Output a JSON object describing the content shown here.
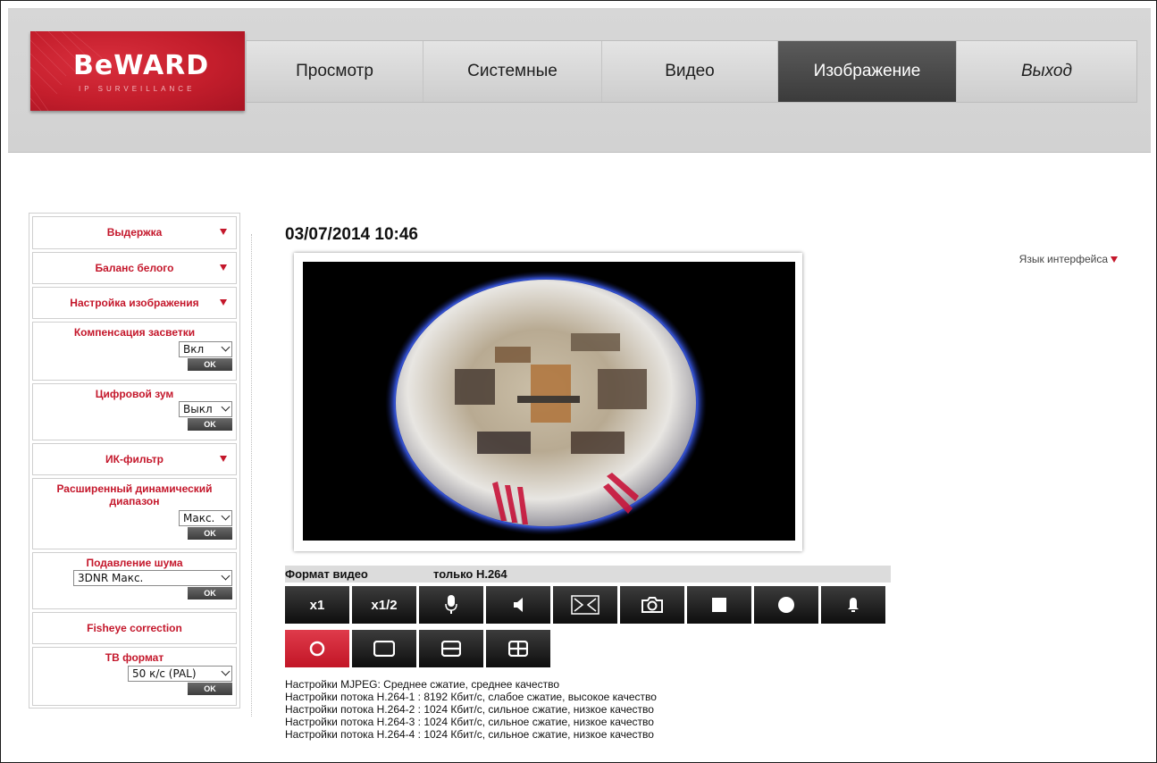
{
  "header": {
    "logo_text": "BeWARD",
    "logo_sub": "IP SURVEILLANCE",
    "nav": [
      {
        "label": "Просмотр"
      },
      {
        "label": "Системные"
      },
      {
        "label": "Видео"
      },
      {
        "label": "Изображение",
        "active": true
      },
      {
        "label": "Выход"
      }
    ]
  },
  "sidebar": {
    "exposure": "Выдержка",
    "white_balance": "Баланс белого",
    "image_settings": "Настройка изображения",
    "backlight": {
      "title": "Компенсация засветки",
      "value": "Вкл",
      "ok": "OK"
    },
    "digital_zoom": {
      "title": "Цифровой зум",
      "value": "Выкл",
      "ok": "OK"
    },
    "ir_filter": "ИК-фильтр",
    "wdr": {
      "title": "Расширенный динамический диапазон",
      "value": "Макс.",
      "ok": "OK"
    },
    "noise": {
      "title": "Подавление шума",
      "value": "3DNR Макс.",
      "ok": "OK"
    },
    "fisheye": "Fisheye correction",
    "tv_format": {
      "title": "ТВ формат",
      "value": "50 к/с (PAL)",
      "ok": "OK"
    }
  },
  "main": {
    "datetime": "03/07/2014 10:46",
    "language": "Язык интерфейса",
    "format_label": "Формат видео",
    "format_value": "только H.264",
    "buttons_row1": [
      "x1",
      "x1/2"
    ],
    "settings_lines": [
      "Настройки MJPEG: Среднее сжатие, среднее качество",
      "Настройки потока H.264-1 : 8192 Кбит/с, слабое сжатие, высокое качество",
      "Настройки потока H.264-2 : 1024 Кбит/с, сильное сжатие, низкое качество",
      "Настройки потока H.264-3 : 1024 Кбит/с, сильное сжатие, низкое качество",
      "Настройки потока H.264-4 : 1024 Кбит/с, сильное сжатие, низкое качество"
    ]
  },
  "colors": {
    "accent": "#c4172b",
    "nav_active": "#4a4a4a"
  }
}
